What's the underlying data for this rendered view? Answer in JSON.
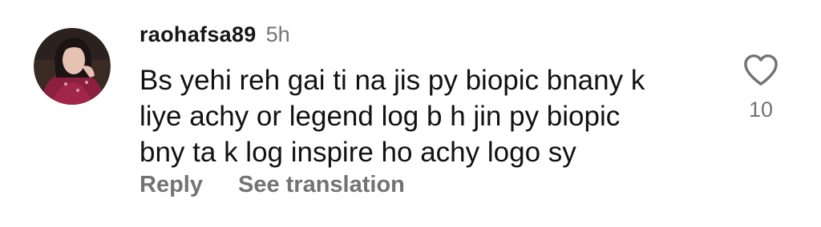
{
  "comment": {
    "username": "raohafsa89",
    "time": "5h",
    "text_lines": [
      "Bs yehi reh gai ti na jis py biopic bnany k",
      "liye achy or legend log b h jin py biopic",
      "bny ta k log inspire ho achy logo sy"
    ],
    "actions": {
      "reply": "Reply",
      "translate": "See translation"
    },
    "likes": "10",
    "like_icon": "heart-outline-icon",
    "colors": {
      "text": "#121212",
      "muted": "#737373"
    }
  }
}
